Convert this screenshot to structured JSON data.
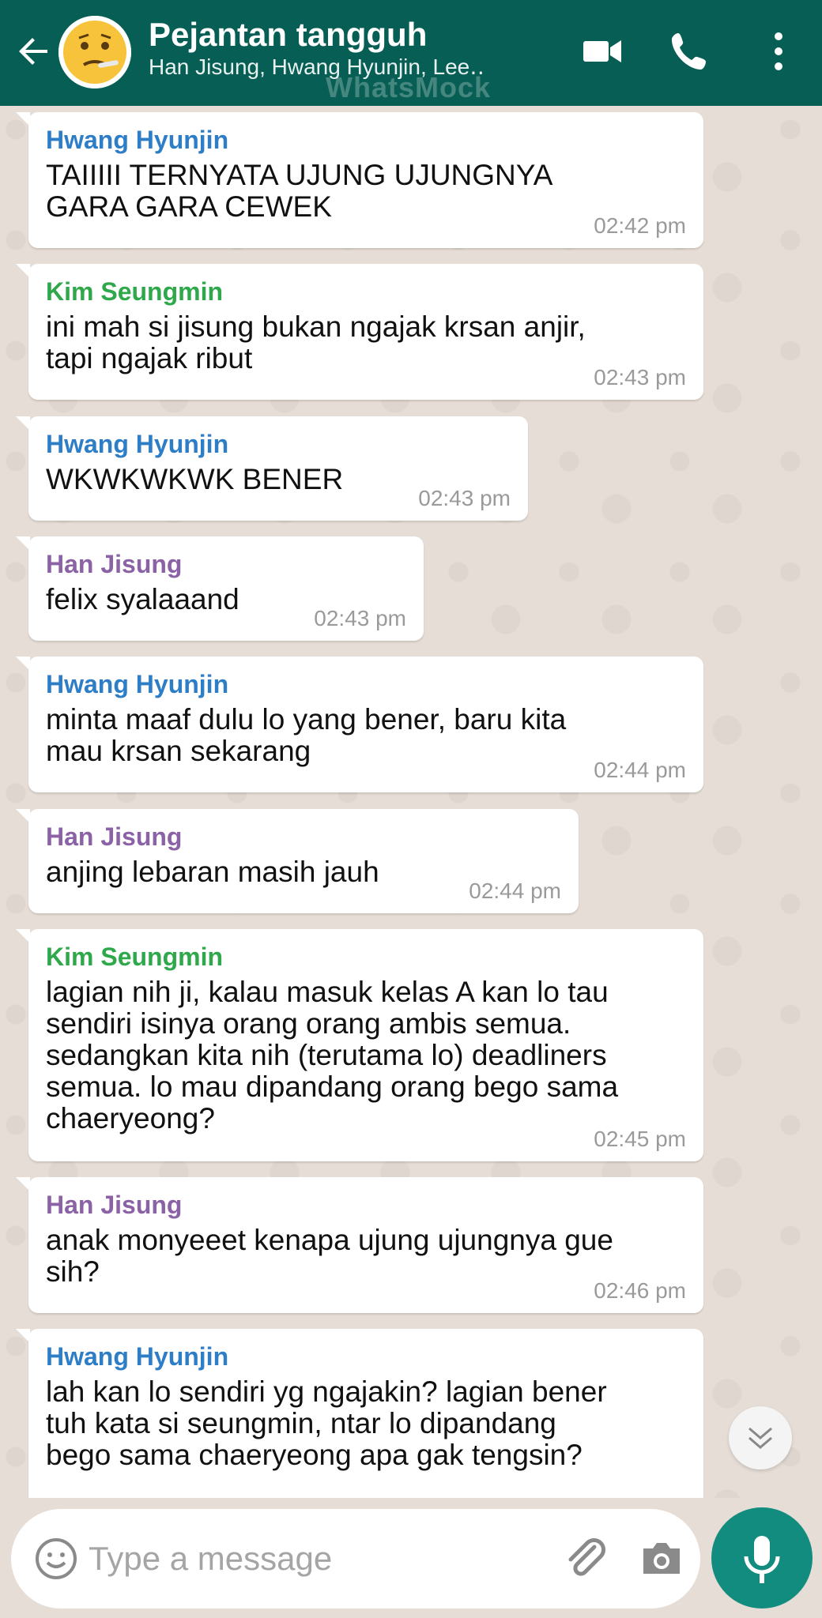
{
  "header": {
    "title": "Pejantan tangguh",
    "subtitle": "Han Jisung, Hwang Hyunjin, Lee․․",
    "watermark": "WhatsMock",
    "icons": [
      "back-arrow-icon",
      "video-call-icon",
      "phone-icon",
      "more-options-icon"
    ]
  },
  "messages": [
    {
      "sender": "Hwang Hyunjin",
      "color": "#2d7ec7",
      "text": "TAIIIII TERNYATA UJUNG UJUNGNYA\nGARA GARA CEWEK",
      "time": "02:42 pm"
    },
    {
      "sender": "Kim Seungmin",
      "color": "#2ea84a",
      "text": "ini mah si jisung bukan ngajak krsan anjir,\ntapi ngajak ribut",
      "time": "02:43 pm"
    },
    {
      "sender": "Hwang Hyunjin",
      "color": "#2d7ec7",
      "text": "WKWKWKWK BENER",
      "time": "02:43 pm"
    },
    {
      "sender": "Han Jisung",
      "color": "#8b62a6",
      "text": "felix syalaaand",
      "time": "02:43 pm"
    },
    {
      "sender": "Hwang Hyunjin",
      "color": "#2d7ec7",
      "text": "minta maaf dulu lo yang bener, baru kita\nmau krsan sekarang",
      "time": "02:44 pm"
    },
    {
      "sender": "Han Jisung",
      "color": "#8b62a6",
      "text": "anjing lebaran masih jauh",
      "time": "02:44 pm"
    },
    {
      "sender": "Kim Seungmin",
      "color": "#2ea84a",
      "text": "lagian nih ji, kalau masuk kelas A kan lo tau\nsendiri isinya orang orang ambis semua.\nsedangkan kita nih (terutama lo) deadliners\nsemua. lo mau dipandang orang bego sama\nchaeryeong?",
      "time": "02:45 pm"
    },
    {
      "sender": "Han Jisung",
      "color": "#8b62a6",
      "text": "anak monyeeet kenapa ujung ujungnya gue\nsih?",
      "time": "02:46 pm"
    },
    {
      "sender": "Hwang Hyunjin",
      "color": "#2d7ec7",
      "text": "lah kan lo sendiri yg ngajakin? lagian bener\ntuh kata si seungmin, ntar lo dipandang\nbego sama chaeryeong apa gak tengsin?",
      "time": ""
    }
  ],
  "input": {
    "placeholder": "Type a message",
    "value": ""
  },
  "colors": {
    "header": "#075e54",
    "chat_background": "#e6ded6",
    "mic_button": "#128c7e"
  }
}
